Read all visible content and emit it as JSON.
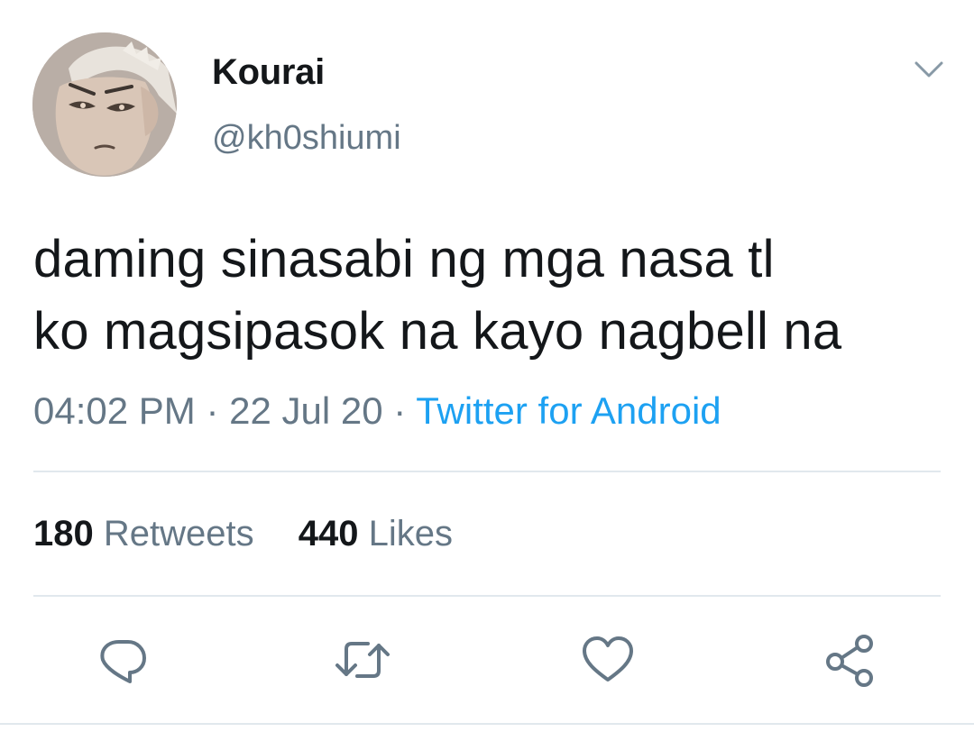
{
  "user": {
    "display_name": "Kourai",
    "handle": "@kh0shiumi"
  },
  "tweet": {
    "lines": [
      "daming sinasabi ng mga nasa tl",
      "ko magsipasok na kayo nagbell na"
    ],
    "time": "04:02 PM",
    "date": "22 Jul 20",
    "separator": "·",
    "source": "Twitter for Android"
  },
  "stats": {
    "retweets_count": "180",
    "retweets_label": "Retweets",
    "likes_count": "440",
    "likes_label": "Likes"
  },
  "icons": {
    "caret": "chevron-down-icon",
    "reply": "reply-icon",
    "retweet": "retweet-icon",
    "like": "heart-icon",
    "share": "share-icon"
  },
  "colors": {
    "text": "#14171a",
    "secondary": "#657786",
    "link": "#1da1f2",
    "divider": "#e1e8ed",
    "icon": "#657786"
  }
}
